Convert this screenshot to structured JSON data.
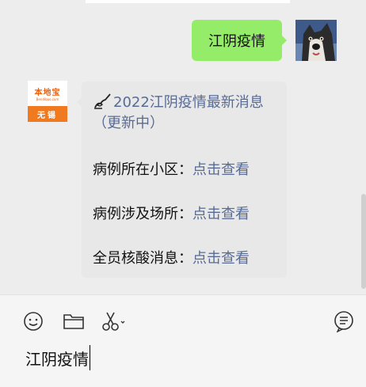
{
  "chat": {
    "outgoing": {
      "text": "江阴疫情"
    },
    "incoming": {
      "sender_logo": {
        "name": "本地宝",
        "url": "Bendibao.com",
        "city": "无锡"
      },
      "title": "2022江阴疫情最新消息（更新中）",
      "rows": [
        {
          "label": "病例所在小区：",
          "link": "点击查看"
        },
        {
          "label": "病例涉及场所：",
          "link": "点击查看"
        },
        {
          "label": "全员核酸消息：",
          "link": "点击查看"
        }
      ]
    }
  },
  "toolbar": {
    "icons": [
      "emoji-icon",
      "folder-icon",
      "scissors-icon",
      "chat-history-icon"
    ]
  },
  "input": {
    "value": "江阴疫情"
  },
  "colors": {
    "outgoing_bubble": "#95ec69",
    "incoming_bubble": "#e8e8e8",
    "link": "#576b95",
    "logo_orange": "#f07a1f"
  }
}
